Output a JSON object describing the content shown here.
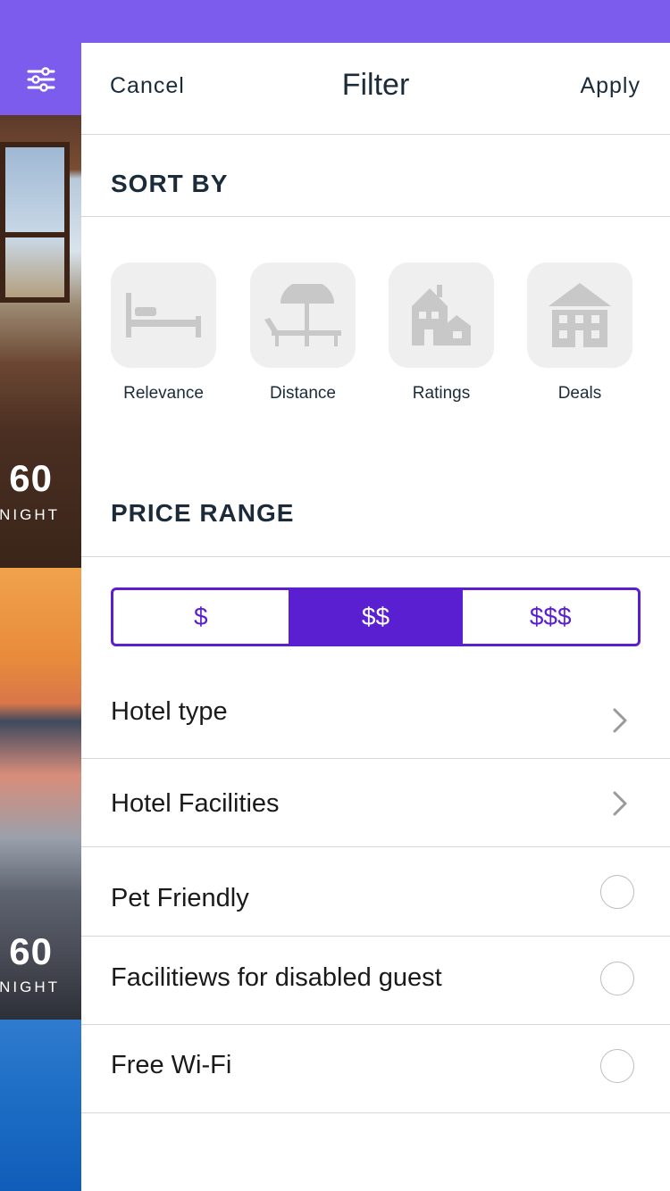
{
  "theme": {
    "accent": "#7c5cec",
    "segment_accent": "#5a1fd1",
    "tile_bg": "#efefef",
    "icon_gray": "#c8c8c8"
  },
  "background_list": {
    "items": [
      {
        "price": "60",
        "unit": "NIGHT"
      },
      {
        "price": "60",
        "unit": "NIGHT"
      }
    ]
  },
  "header": {
    "cancel": "Cancel",
    "title": "Filter",
    "apply": "Apply"
  },
  "sort": {
    "title": "SORT BY",
    "options": [
      {
        "label": "Relevance",
        "icon": "bed-icon"
      },
      {
        "label": "Distance",
        "icon": "beach-umbrella-icon"
      },
      {
        "label": "Ratings",
        "icon": "houses-icon"
      },
      {
        "label": "Deals",
        "icon": "building-icon"
      }
    ]
  },
  "price": {
    "title": "PRICE RANGE",
    "options": [
      "$",
      "$$",
      "$$$"
    ],
    "selected": "$$"
  },
  "rows": [
    {
      "label": "Hotel type",
      "control": "chevron"
    },
    {
      "label": "Hotel Facilities",
      "control": "chevron"
    },
    {
      "label": "Pet Friendly",
      "control": "radio",
      "checked": false
    },
    {
      "label": "Facilitiews for disabled guest",
      "control": "radio",
      "checked": false
    },
    {
      "label": "Free Wi-Fi",
      "control": "radio",
      "checked": false
    }
  ]
}
